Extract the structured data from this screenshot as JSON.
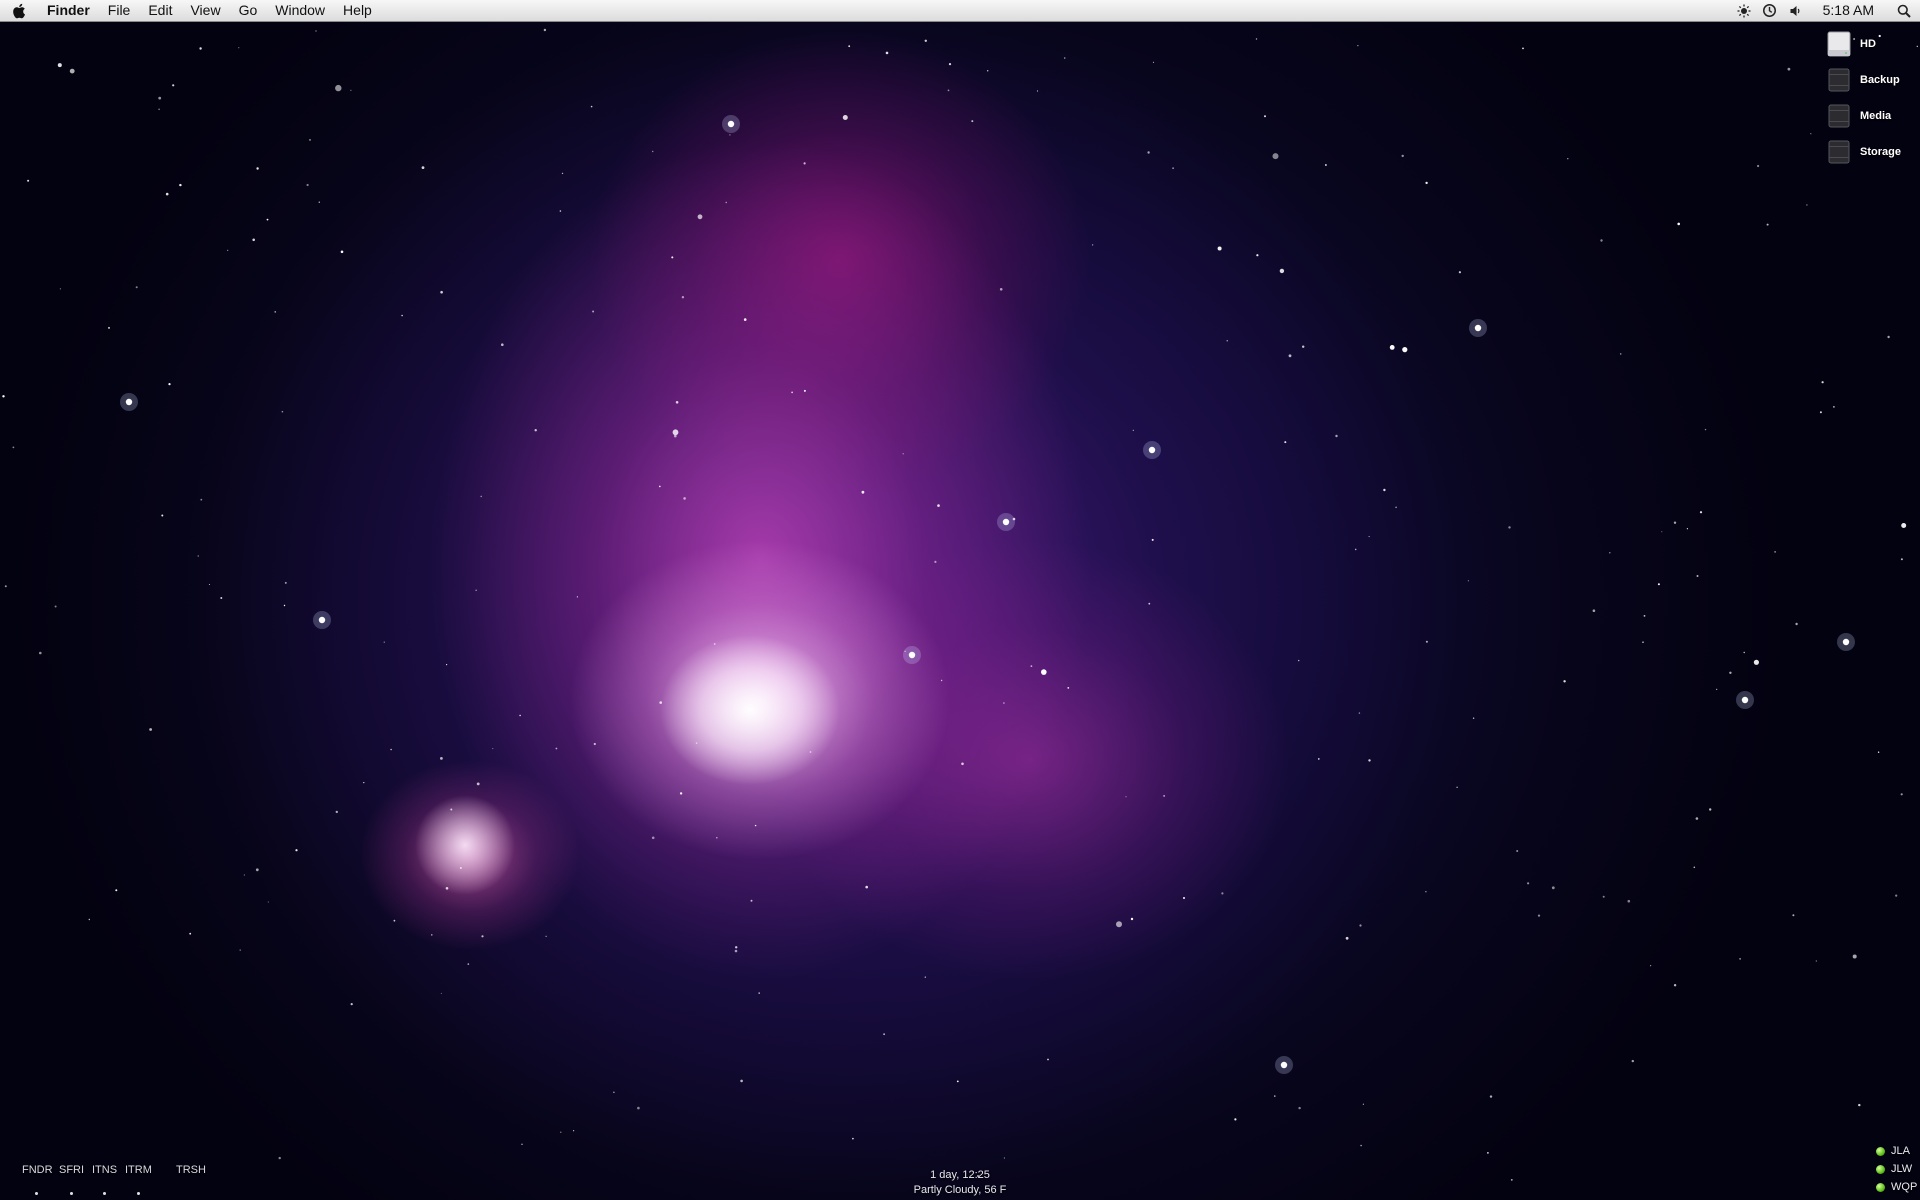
{
  "menubar": {
    "apple_icon": "apple-icon",
    "app_name": "Finder",
    "menus": [
      "File",
      "Edit",
      "View",
      "Go",
      "Window",
      "Help"
    ],
    "status_icons": [
      "brightness-icon",
      "time-machine-icon",
      "volume-icon"
    ],
    "clock": "5:18 AM",
    "spotlight_icon": "spotlight-search-icon"
  },
  "desktop": {
    "drives": [
      {
        "label": "HD",
        "icon": "hard-drive-icon"
      },
      {
        "label": "Backup",
        "icon": "external-drive-icon"
      },
      {
        "label": "Media",
        "icon": "external-drive-icon"
      },
      {
        "label": "Storage",
        "icon": "external-drive-icon"
      }
    ]
  },
  "dock": {
    "items": [
      "FNDR",
      "SFRI",
      "ITNS",
      "ITRM",
      "TRSH"
    ]
  },
  "info": {
    "uptime": "1 day, 12:25",
    "weather": "Partly Cloudy, 56 F"
  },
  "buddies": [
    "JLA",
    "JLW",
    "WQP"
  ],
  "colors": {
    "menubar_bg": "#e6e6e6",
    "nebula_core": "#ffffff",
    "nebula_magenta": "#c046be",
    "space_bg": "#0f0a33",
    "status_available": "#5fbf1a"
  }
}
